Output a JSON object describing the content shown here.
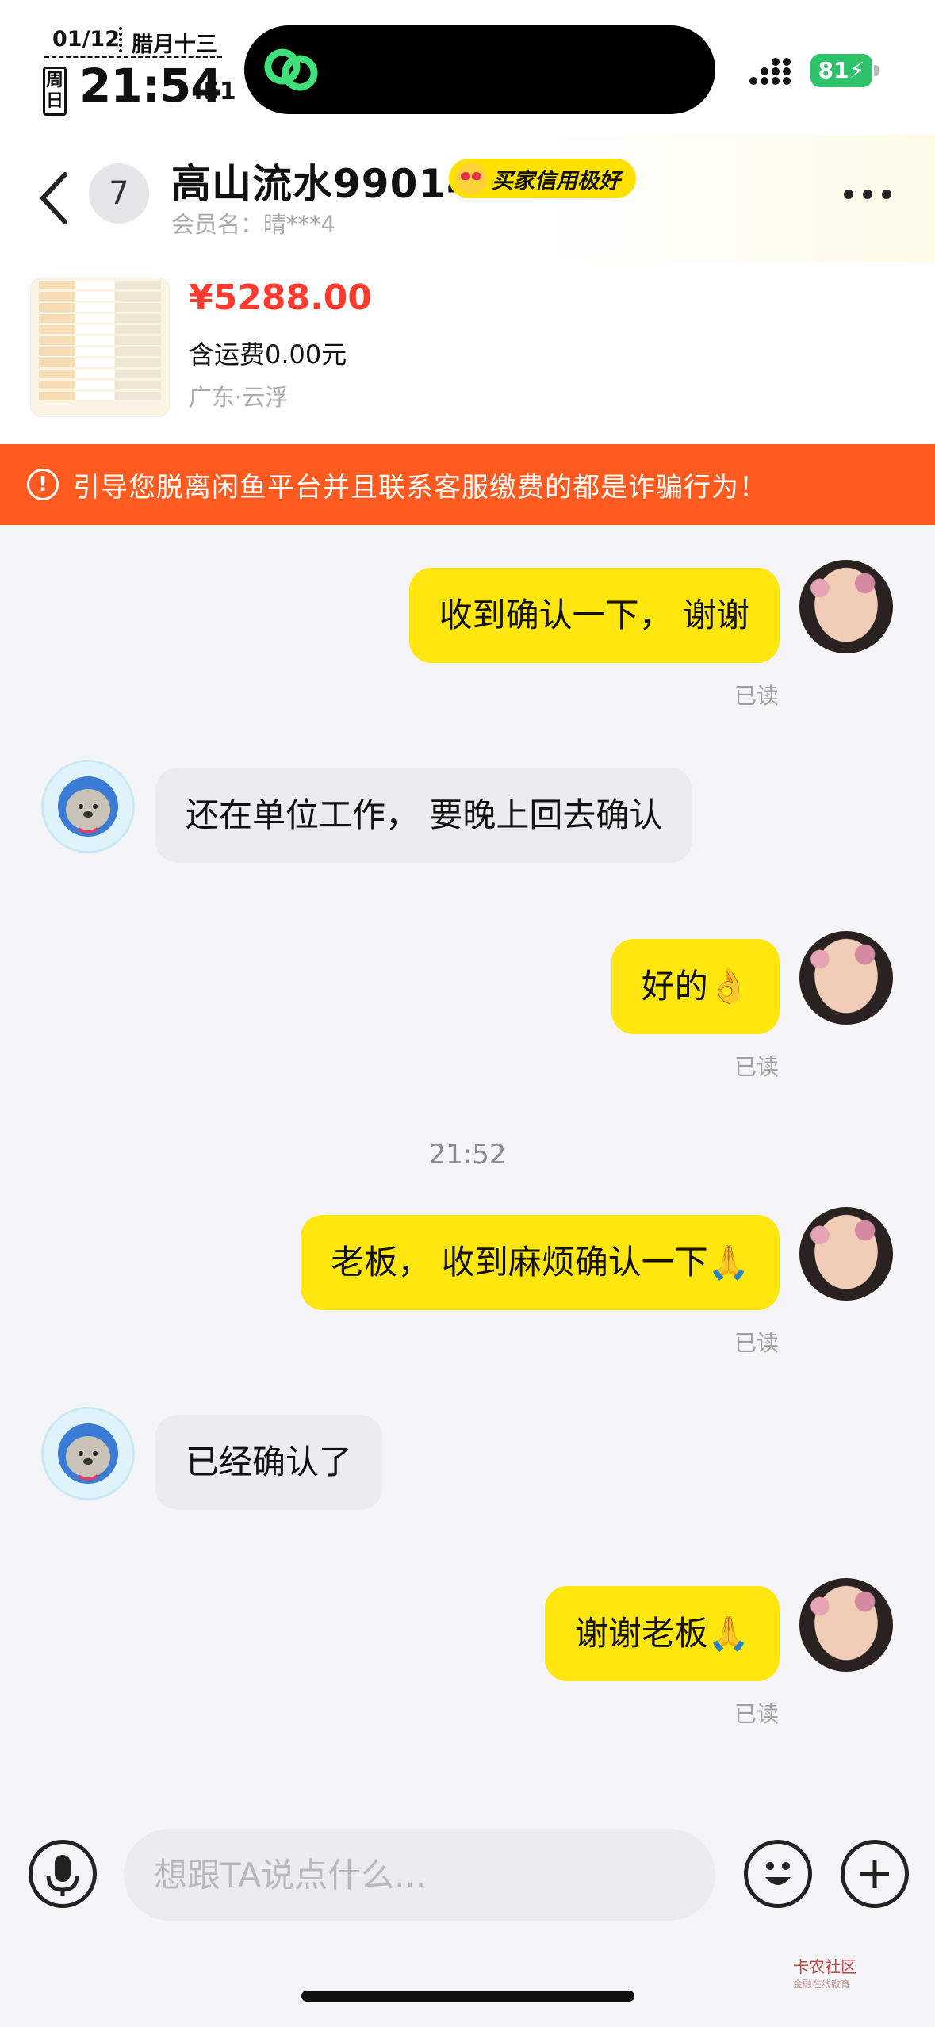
{
  "status_bar": {
    "date": "01/12",
    "lunar": "腊月十三",
    "weekday": "周日",
    "time": "21:54",
    "seconds": ":51",
    "battery": "81"
  },
  "header": {
    "seller_name": "高山流水99014",
    "badge_number": "7",
    "credit_badge": "买家信用极好",
    "member_line": "会员名：晴***4"
  },
  "item": {
    "price": "¥5288.00",
    "shipping": "含运费0.00元",
    "location": "广东·云浮"
  },
  "warning": {
    "icon": "!",
    "text": "引导您脱离闲鱼平台并且联系客服缴费的都是诈骗行为！"
  },
  "messages": [
    {
      "side": "mine",
      "text": "收到确认一下， 谢谢",
      "status": "已读"
    },
    {
      "side": "theirs",
      "text": "还在单位工作， 要晚上回去确认"
    },
    {
      "side": "mine",
      "text": "好的👌",
      "status": "已读"
    },
    {
      "side": "mine",
      "text": "老板， 收到麻烦确认一下🙏",
      "status": "已读"
    },
    {
      "side": "theirs",
      "text": "已经确认了"
    },
    {
      "side": "mine",
      "text": "谢谢老板🙏",
      "status": "已读"
    }
  ],
  "timestamp": "21:52",
  "input": {
    "placeholder": "想跟TA说点什么..."
  },
  "watermark": {
    "brand": "卡农社区",
    "sub": "金融在线教育"
  },
  "colors": {
    "accent": "#ffe60f",
    "warning": "#ff5a1f",
    "price": "#ff3b30"
  }
}
